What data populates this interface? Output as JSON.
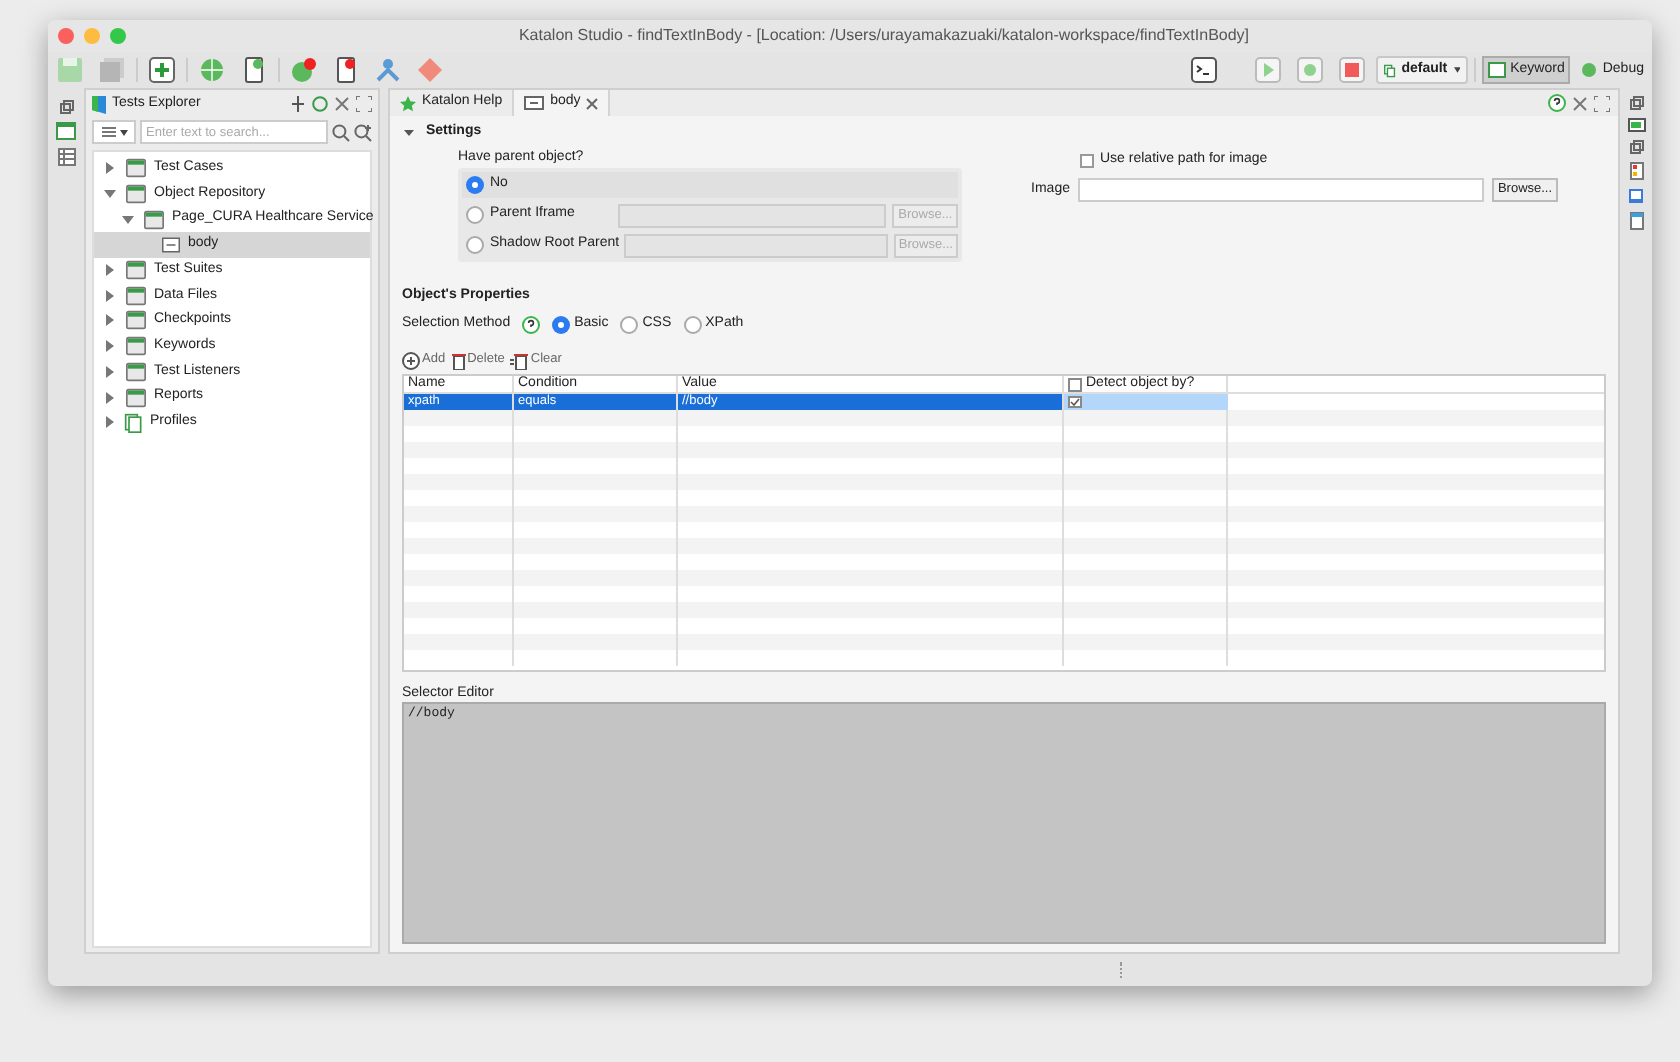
{
  "window": {
    "title": "Katalon Studio - findTextInBody - [Location: /Users/urayamakazuaki/katalon-workspace/findTextInBody]"
  },
  "toolbar": {
    "run_config": "default",
    "perspectives": [
      {
        "label": "Keyword",
        "selected": true
      },
      {
        "label": "Debug",
        "selected": false
      }
    ]
  },
  "explorer": {
    "title": "Tests Explorer",
    "search": {
      "placeholder": "Enter text to search..."
    },
    "tree": [
      {
        "label": "Test Cases",
        "expanded": false,
        "selected": false
      },
      {
        "label": "Object Repository",
        "expanded": true,
        "selected": false,
        "children": [
          {
            "label": "Page_CURA Healthcare Service",
            "expanded": true,
            "selected": false,
            "children": [
              {
                "label": "body",
                "kind": "object",
                "selected": true
              }
            ]
          }
        ]
      },
      {
        "label": "Test Suites",
        "expanded": false,
        "selected": false
      },
      {
        "label": "Data Files",
        "expanded": false,
        "selected": false
      },
      {
        "label": "Checkpoints",
        "expanded": false,
        "selected": false
      },
      {
        "label": "Keywords",
        "expanded": false,
        "selected": false
      },
      {
        "label": "Test Listeners",
        "expanded": false,
        "selected": false
      },
      {
        "label": "Reports",
        "expanded": false,
        "selected": false
      },
      {
        "label": "Profiles",
        "kind": "profiles",
        "expanded": false,
        "selected": false
      }
    ]
  },
  "editor_tabs": [
    {
      "label": "Katalon Help",
      "kind": "help",
      "selected": false
    },
    {
      "label": "body",
      "kind": "object",
      "selected": true
    }
  ],
  "settings": {
    "title": "Settings",
    "expanded": true,
    "parent_label": "Have parent object?",
    "parent_options": [
      {
        "label": "No",
        "selected": true
      },
      {
        "label": "Parent Iframe",
        "selected": false,
        "browse": "Browse...",
        "disabled": true
      },
      {
        "label": "Shadow Root Parent",
        "selected": false,
        "browse": "Browse...",
        "disabled": true
      }
    ],
    "relative_path": {
      "label": "Use relative path for image",
      "checked": false
    },
    "image": {
      "label": "Image",
      "button": "Browse..."
    }
  },
  "properties": {
    "title": "Object's Properties",
    "selection_label": "Selection Method",
    "methods": [
      {
        "label": "Basic",
        "selected": true
      },
      {
        "label": "CSS",
        "selected": false
      },
      {
        "label": "XPath",
        "selected": false
      }
    ],
    "actions": [
      {
        "label": "Add",
        "kind": "add"
      },
      {
        "label": "Delete",
        "kind": "delete"
      },
      {
        "label": "Clear",
        "kind": "clear"
      }
    ],
    "columns": [
      "Name",
      "Condition",
      "Value",
      "Detect object by?"
    ],
    "rows": [
      {
        "name": "xpath",
        "condition": "equals",
        "value": "//body",
        "detect": true,
        "selected": true
      }
    ]
  },
  "selector_editor": {
    "label": "Selector Editor",
    "value": "//body"
  }
}
